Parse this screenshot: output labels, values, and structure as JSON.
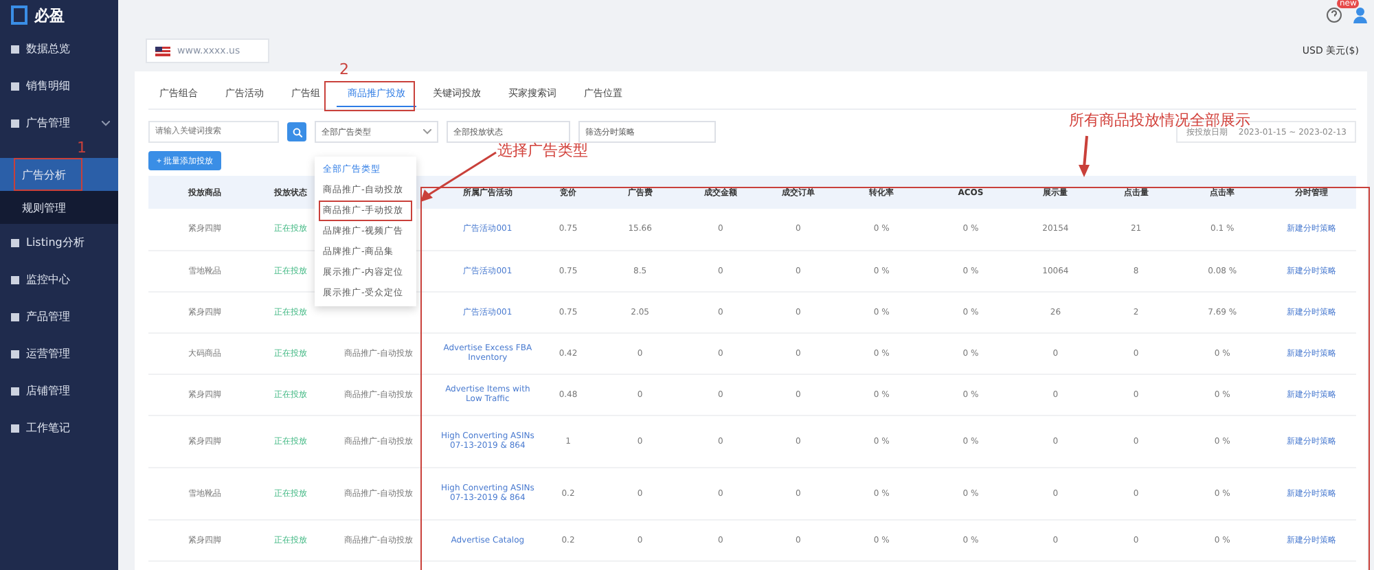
{
  "sidebar": {
    "logo": "必盈",
    "items": [
      {
        "label": "数据总览",
        "kind": "item",
        "selected": false
      },
      {
        "label": "销售明细",
        "kind": "item",
        "selected": false
      },
      {
        "label": "广告管理",
        "kind": "group",
        "expanded": true,
        "selected": false,
        "children": [
          {
            "label": "广告分析",
            "selected": true
          },
          {
            "label": "规则管理",
            "selected": false
          }
        ]
      },
      {
        "label": "Listing分析",
        "kind": "item",
        "selected": false
      },
      {
        "label": "监控中心",
        "kind": "item",
        "selected": false
      },
      {
        "label": "产品管理",
        "kind": "item",
        "selected": false
      },
      {
        "label": "运营管理",
        "kind": "item",
        "selected": false
      },
      {
        "label": "店铺管理",
        "kind": "item",
        "selected": false
      },
      {
        "label": "工作笔记",
        "kind": "item",
        "selected": false
      }
    ]
  },
  "header": {
    "badge": "new",
    "store": "www.xxxx.us",
    "currency": "USD 美元($)"
  },
  "tabs": [
    {
      "label": "广告组合",
      "selected": false
    },
    {
      "label": "广告活动",
      "selected": false
    },
    {
      "label": "广告组",
      "selected": false
    },
    {
      "label": "商品推广投放",
      "selected": true
    },
    {
      "label": "关键词投放",
      "selected": false
    },
    {
      "label": "买家搜索词",
      "selected": false
    },
    {
      "label": "广告位置",
      "selected": false
    }
  ],
  "filters": {
    "search": {
      "placeholder": "请输入关键词搜索"
    },
    "ad_type": "全部广告类型",
    "status": "全部投放状态",
    "schedule": "筛选分时策略",
    "date_label": "按投放日期",
    "date_range": "2023-01-15 ~ 2023-02-13"
  },
  "add_button": "+ 批量添加投放",
  "dropdown": {
    "options": [
      {
        "label": "全部广告类型",
        "selected": true,
        "highlighted": false
      },
      {
        "label": "商品推广-自动投放",
        "selected": false,
        "highlighted": false
      },
      {
        "label": "商品推广-手动投放",
        "selected": false,
        "highlighted": true
      },
      {
        "label": "品牌推广-视频广告",
        "selected": false,
        "highlighted": false
      },
      {
        "label": "品牌推广-商品集",
        "selected": false,
        "highlighted": false
      },
      {
        "label": "展示推广-内容定位",
        "selected": false,
        "highlighted": false
      },
      {
        "label": "展示推广-受众定位",
        "selected": false,
        "highlighted": false
      }
    ]
  },
  "table": {
    "columns": [
      "投放商品",
      "投放状态",
      null,
      "所属广告活动",
      "竞价",
      "广告费",
      "成交金额",
      "成交订单",
      "转化率",
      "ACOS",
      "展示量",
      "点击量",
      "点击率",
      "分时管理"
    ],
    "rows": [
      {
        "product": "紧身四脚",
        "status": "正在投放",
        "campaign": "广告活动001",
        "bid": "0.75",
        "spend": "15.66",
        "sales": "0",
        "orders": "0",
        "cvr": "0 %",
        "acos": "0 %",
        "impressions": "20154",
        "clicks": "21",
        "ctr": "0.1 %",
        "action": "新建分时策略"
      },
      {
        "product": "雪地靴品",
        "status": "正在投放",
        "campaign": "广告活动001",
        "bid": "0.75",
        "spend": "8.5",
        "sales": "0",
        "orders": "0",
        "cvr": "0 %",
        "acos": "0 %",
        "impressions": "10064",
        "clicks": "8",
        "ctr": "0.08 %",
        "action": "新建分时策略"
      },
      {
        "product": "紧身四脚",
        "status": "正在投放",
        "campaign": "广告活动001",
        "bid": "0.75",
        "spend": "2.05",
        "sales": "0",
        "orders": "0",
        "cvr": "0 %",
        "acos": "0 %",
        "impressions": "26",
        "clicks": "2",
        "ctr": "7.69 %",
        "action": "新建分时策略"
      },
      {
        "product": "大码商品",
        "status": "正在投放",
        "ad_type": "商品推广-自动投放",
        "campaign": "Advertise Excess FBA Inventory",
        "bid": "0.42",
        "spend": "0",
        "sales": "0",
        "orders": "0",
        "cvr": "0 %",
        "acos": "0 %",
        "impressions": "0",
        "clicks": "0",
        "ctr": "0 %",
        "action": "新建分时策略"
      },
      {
        "product": "紧身四脚",
        "status": "正在投放",
        "ad_type": "商品推广-自动投放",
        "campaign": "Advertise Items with Low Traffic",
        "bid": "0.48",
        "spend": "0",
        "sales": "0",
        "orders": "0",
        "cvr": "0 %",
        "acos": "0 %",
        "impressions": "0",
        "clicks": "0",
        "ctr": "0 %",
        "action": "新建分时策略"
      },
      {
        "product": "紧身四脚",
        "status": "正在投放",
        "ad_type": "商品推广-自动投放",
        "campaign": "High Converting ASINs 07-13-2019 & 864",
        "bid": "1",
        "spend": "0",
        "sales": "0",
        "orders": "0",
        "cvr": "0 %",
        "acos": "0 %",
        "impressions": "0",
        "clicks": "0",
        "ctr": "0 %",
        "action": "新建分时策略"
      },
      {
        "product": "雪地靴品",
        "status": "正在投放",
        "ad_type": "商品推广-自动投放",
        "campaign": "High Converting ASINs 07-13-2019 & 864",
        "bid": "0.2",
        "spend": "0",
        "sales": "0",
        "orders": "0",
        "cvr": "0 %",
        "acos": "0 %",
        "impressions": "0",
        "clicks": "0",
        "ctr": "0 %",
        "action": "新建分时策略"
      },
      {
        "product": "紧身四脚",
        "status": "正在投放",
        "ad_type": "商品推广-自动投放",
        "campaign": "Advertise Catalog",
        "bid": "0.2",
        "spend": "0",
        "sales": "0",
        "orders": "0",
        "cvr": "0 %",
        "acos": "0 %",
        "impressions": "0",
        "clicks": "0",
        "ctr": "0 %",
        "action": "新建分时策略"
      }
    ]
  },
  "annotations": [
    {
      "kind": "step",
      "text": "1"
    },
    {
      "kind": "step",
      "text": "2"
    },
    {
      "kind": "callout",
      "text": "选择广告类型"
    },
    {
      "kind": "callout",
      "text": "所有商品投放情况全部展示"
    }
  ]
}
